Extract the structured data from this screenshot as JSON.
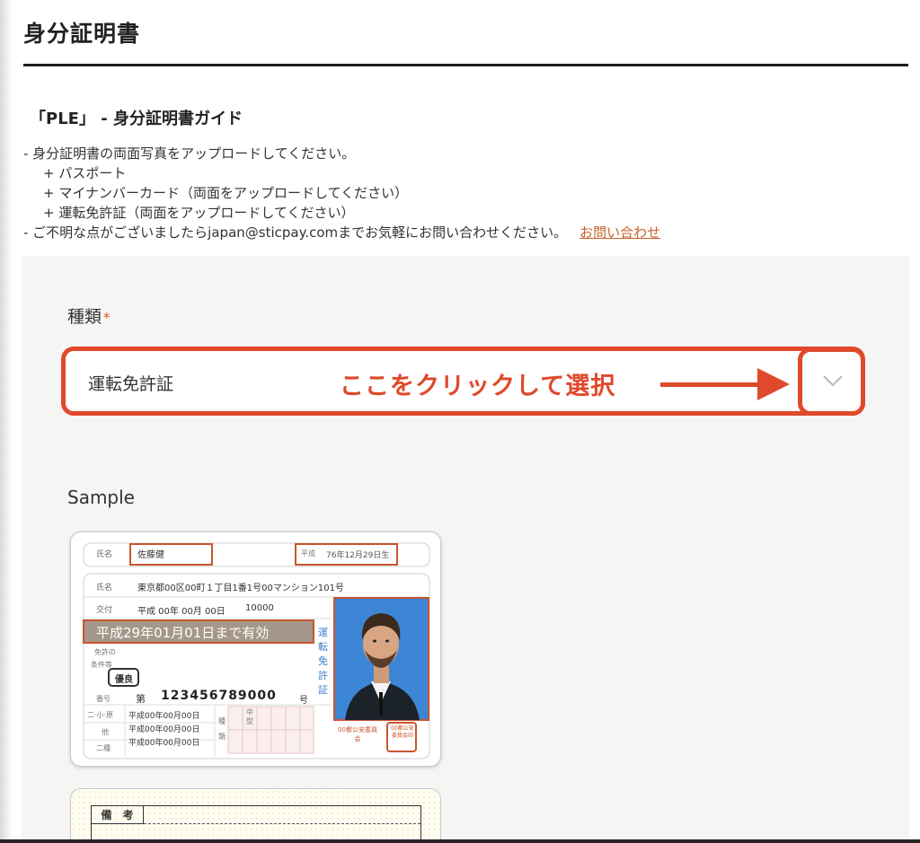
{
  "page": {
    "title": "身分証明書"
  },
  "guide": {
    "heading": "「PLE」 - 身分証明書ガイド",
    "line1": "- 身分証明書の両面写真をアップロードしてください。",
    "item_passport": "+ パスポート",
    "item_mynumber": "+ マイナンバーカード（両面をアップロードしてください）",
    "item_license": "+ 運転免許証（両面をアップロードしてください）",
    "line2": "- ご不明な点がございましたらjapan@sticpay.comまでお気軽にお問い合わせください。",
    "contact_link": "お問い合わせ"
  },
  "form": {
    "type_label": "種類",
    "required_mark": "*",
    "type_value": "運転免許証",
    "annotation": "ここをクリックして選択",
    "sample_label": "Sample"
  },
  "license_card": {
    "name_label": "氏名",
    "name_value": "佐藤健",
    "dob_era": "平成",
    "dob_value": "76年12月29日生",
    "address_label": "氏名",
    "address_value": "東京都00区00町１丁目1番1号00マンション101号",
    "issue_label": "交付",
    "issue_value": "平成 00年 00月 00日",
    "issue_number": "10000",
    "valid_until": "平成29年01月01日まで有効",
    "conditions_label_1": "免許の",
    "conditions_label_2": "条件等",
    "excellent_badge": "優良",
    "number_label": "番号",
    "number_prefix": "第",
    "number_value": "123456789000",
    "number_suffix": "号",
    "class_row1_label": "二·小·原",
    "class_row2_label": "他",
    "class_row3_label": "二種",
    "class_row1_date": "平成00年00月00日",
    "class_row2_date": "平成00年00月00日",
    "class_row3_date": "平成00年00月00日",
    "type_label_1": "種",
    "type_label_2": "類",
    "type_mid": "中型",
    "vertical_title": "運転免許証",
    "authority": "00都公安委員会",
    "seal_text": "00都公安委員会印",
    "remarks_label": "備　考"
  },
  "colors": {
    "accent": "#e0492b",
    "link": "#c9602a",
    "panel_bg": "#f5f5f4",
    "card_orange": "#c9552f",
    "photo_bg": "#3d86d6"
  }
}
